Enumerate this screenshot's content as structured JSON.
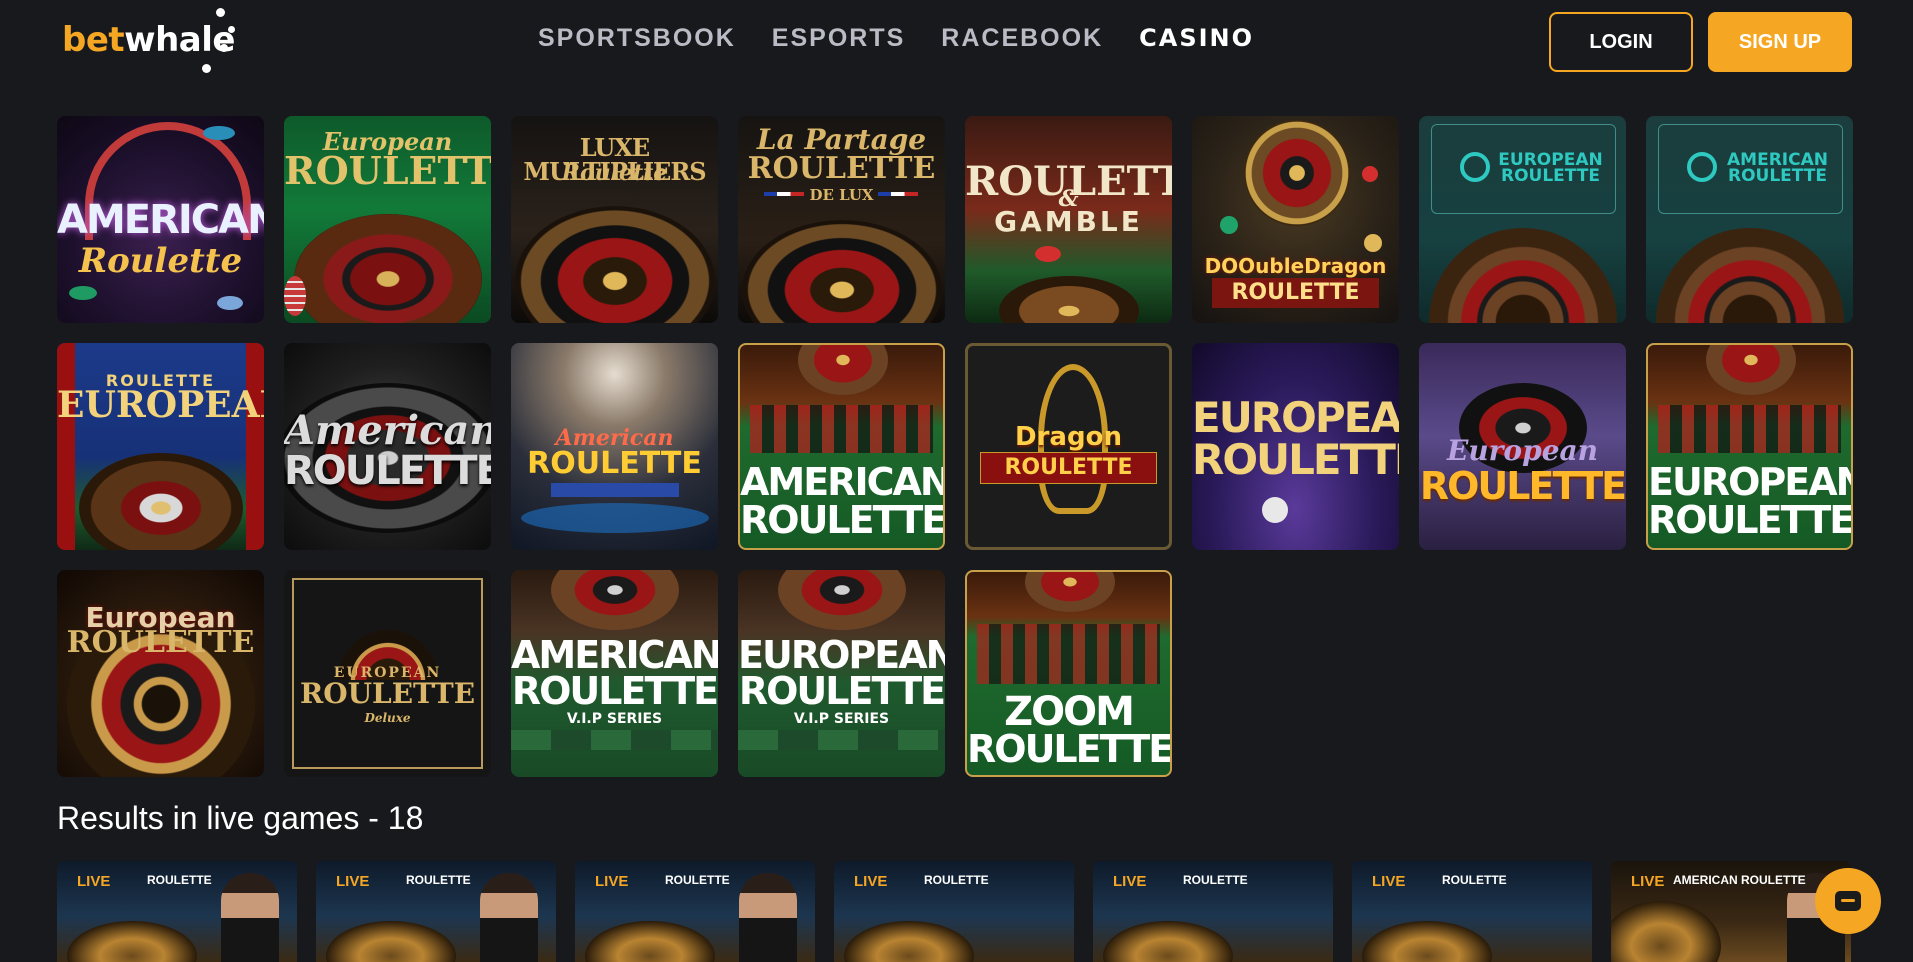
{
  "header": {
    "logo": {
      "part1": "bet",
      "part2": "whale"
    },
    "nav": [
      "SPORTSBOOK",
      "ESPORTS",
      "RACEBOOK",
      "CASINO"
    ],
    "active_nav": "CASINO",
    "login_label": "LOGIN",
    "signup_label": "SIGN UP"
  },
  "games": [
    {
      "line1": "AMERICAN",
      "line2": "Roulette",
      "line3": ""
    },
    {
      "line1": "European",
      "line2": "ROULETTE",
      "line3": ""
    },
    {
      "line1": "LUXE MULTIPLIERS",
      "line2": "Roulette",
      "line3": ""
    },
    {
      "line1": "La Partage",
      "line2": "ROULETTE",
      "line3": "DE LUX"
    },
    {
      "line1": "ROULETTE",
      "line2": "&",
      "line3": "GAMBLE"
    },
    {
      "line1": "DOOubleDragon",
      "line2": "ROULETTE",
      "line3": ""
    },
    {
      "line1": "EUROPEAN",
      "line2": "ROULETTE",
      "line3": ""
    },
    {
      "line1": "AMERICAN",
      "line2": "ROULETTE",
      "line3": ""
    },
    {
      "line1": "ROULETTE",
      "line2": "EUROPEAN",
      "line3": ""
    },
    {
      "line1": "American",
      "line2": "ROULETTE",
      "line3": ""
    },
    {
      "line1": "American",
      "line2": "ROULETTE",
      "line3": ""
    },
    {
      "line1": "AMERICAN",
      "line2": "ROULETTE",
      "line3": ""
    },
    {
      "line1": "Dragon",
      "line2": "ROULETTE",
      "line3": ""
    },
    {
      "line1": "EUROPEAN",
      "line2": "ROULETTE",
      "line3": ""
    },
    {
      "line1": "European",
      "line2": "ROULETTE",
      "line3": ""
    },
    {
      "line1": "EUROPEAN",
      "line2": "ROULETTE",
      "line3": ""
    },
    {
      "line1": "European",
      "line2": "ROULETTE",
      "line3": ""
    },
    {
      "line1": "EUROPEAN",
      "line2": "ROULETTE",
      "line3": "Deluxe"
    },
    {
      "line1": "AMERICAN",
      "line2": "ROULETTE",
      "line3": "V.I.P SERIES"
    },
    {
      "line1": "EUROPEAN",
      "line2": "ROULETTE",
      "line3": "V.I.P SERIES"
    },
    {
      "line1": "ZOOM",
      "line2": "ROULETTE",
      "line3": ""
    }
  ],
  "live_section": {
    "title": "Results in live games - 18",
    "tag": "LIVE",
    "items": [
      "ROULETTE",
      "ROULETTE",
      "ROULETTE",
      "ROULETTE",
      "ROULETTE",
      "ROULETTE",
      "AMERICAN ROULETTE"
    ]
  },
  "chat_icon": "chat-bubble-icon",
  "colors": {
    "accent": "#f5a623",
    "background": "#18191d"
  }
}
